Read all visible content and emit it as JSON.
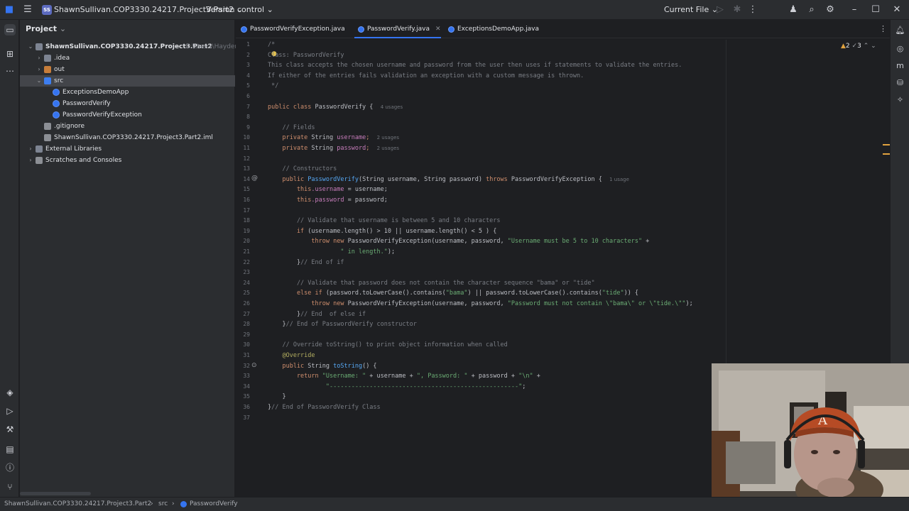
{
  "titlebar": {
    "project_badge": "SS",
    "project_name": "ShawnSullivan.COP3330.24217.Project3.Part2",
    "vcs": "Version control",
    "run_config": "Current File"
  },
  "project_panel": {
    "title": "Project",
    "tree": [
      {
        "label": "ShawnSullivan.COP3330.24217.Project3.Part2",
        "suffix": "C:\\Users\\Hayden",
        "indent": 0,
        "arrow": "open",
        "icon": "folder"
      },
      {
        "label": ".idea",
        "indent": 1,
        "arrow": "closed",
        "icon": "folder"
      },
      {
        "label": "out",
        "indent": 1,
        "arrow": "closed",
        "icon": "folder-orange"
      },
      {
        "label": "src",
        "indent": 1,
        "arrow": "open",
        "icon": "folder-blue",
        "selected": true
      },
      {
        "label": "ExceptionsDemoApp",
        "indent": 2,
        "icon": "class"
      },
      {
        "label": "PasswordVerify",
        "indent": 2,
        "icon": "class"
      },
      {
        "label": "PasswordVerifyException",
        "indent": 2,
        "icon": "class"
      },
      {
        "label": ".gitignore",
        "indent": 1,
        "icon": "file"
      },
      {
        "label": "ShawnSullivan.COP3330.24217.Project3.Part2.iml",
        "indent": 1,
        "icon": "file"
      },
      {
        "label": "External Libraries",
        "indent": 0,
        "arrow": "closed",
        "icon": "lib"
      },
      {
        "label": "Scratches and Consoles",
        "indent": 0,
        "arrow": "closed",
        "icon": "scratch"
      }
    ]
  },
  "tabs": [
    {
      "label": "PasswordVerifyException.java",
      "active": false
    },
    {
      "label": "PasswordVerify.java",
      "active": true
    },
    {
      "label": "ExceptionsDemoApp.java",
      "active": false
    }
  ],
  "inspections": {
    "warnings": "2",
    "weak": "3"
  },
  "code": {
    "line_numbers": [
      "1",
      "2",
      "3",
      "4",
      "5",
      "6",
      "7",
      "8",
      "9",
      "10",
      "11",
      "12",
      "13",
      "14",
      "15",
      "16",
      "17",
      "18",
      "19",
      "20",
      "21",
      "22",
      "23",
      "24",
      "25",
      "26",
      "27",
      "28",
      "29",
      "30",
      "31",
      "32",
      "33",
      "34",
      "35",
      "36",
      "37"
    ],
    "l1": "/*",
    "l2": "Class: PasswordVerify",
    "l3": "This class accepts the chosen username and password from the user then uses if statements to validate the entries.",
    "l4": "If either of the entries fails validation an exception with a custom message is thrown.",
    "l5": " */",
    "l7_kw": "public class ",
    "l7_name": "PasswordVerify",
    "l7_rest": " {",
    "l7_hint": "4 usages",
    "l9": "    // Fields",
    "l10_kw": "    private ",
    "l10_type": "String ",
    "l10_f": "username",
    "l10_hint": "2 usages",
    "l11_kw": "    private ",
    "l11_type": "String ",
    "l11_f": "password",
    "l11_hint": "2 usages",
    "l13": "    // Constructors",
    "l14_kw": "    public ",
    "l14_name": "PasswordVerify",
    "l14_args": "(String username, String password) ",
    "l14_kw2": "throws ",
    "l14_rest": "PasswordVerifyException {",
    "l14_hint": "1 usage",
    "l15_kw": "        this",
    "l15_f": ".username",
    "l15_rest": " = username;",
    "l16_kw": "        this",
    "l16_f": ".password",
    "l16_rest": " = password;",
    "l18": "        // Validate that username is between 5 and 10 characters",
    "l19_kw": "        if ",
    "l19_rest": "(username.length() > 10 || username.length() < 5 ) {",
    "l20_kw": "            throw new ",
    "l20_rest": "PasswordVerifyException(username, password, ",
    "l20_str": "\"Username must be 5 to 10 characters\"",
    "l20_end": " +",
    "l21_str": "                    \" in length.\"",
    "l21_end": ");",
    "l22_a": "        }",
    "l22_c": "// End of if",
    "l24": "        // Validate that password does not contain the character sequence \"bama\" or \"tide\"",
    "l25_kw": "        else if ",
    "l25_rest": "(password.toLowerCase().contains(",
    "l25_s1": "\"bama\"",
    "l25_mid": ") || password.toLowerCase().contains(",
    "l25_s2": "\"tide\"",
    "l25_end": ")) {",
    "l26_kw": "            throw new ",
    "l26_rest": "PasswordVerifyException(username, password, ",
    "l26_str": "\"Password must not contain \\\"bama\\\" or \\\"tide.\\\"\"",
    "l26_end": ");",
    "l27_a": "        }",
    "l27_c": "// End  of else if",
    "l28_a": "    }",
    "l28_c": "// End of PasswordVerify constructor",
    "l30": "    // Override toString() to print object information when called",
    "l31": "    @Override",
    "l32_kw": "    public ",
    "l32_type": "String ",
    "l32_name": "toString",
    "l32_rest": "() {",
    "l33_kw": "        return ",
    "l33_s1": "\"Username: \"",
    "l33_m1": " + username + ",
    "l33_s2": "\", Password: \"",
    "l33_m2": " + password + ",
    "l33_s3": "\"\\n\"",
    "l33_end": " +",
    "l34_str": "                \"----------------------------------------------------\"",
    "l34_end": ";",
    "l35": "    }",
    "l36_a": "}",
    "l36_c": "// End of PasswordVerify Class"
  },
  "statusbar": {
    "crumb1": "ShawnSullivan.COP3330.24217.Project3.Part2",
    "crumb2": "src",
    "crumb3": "PasswordVerify"
  }
}
